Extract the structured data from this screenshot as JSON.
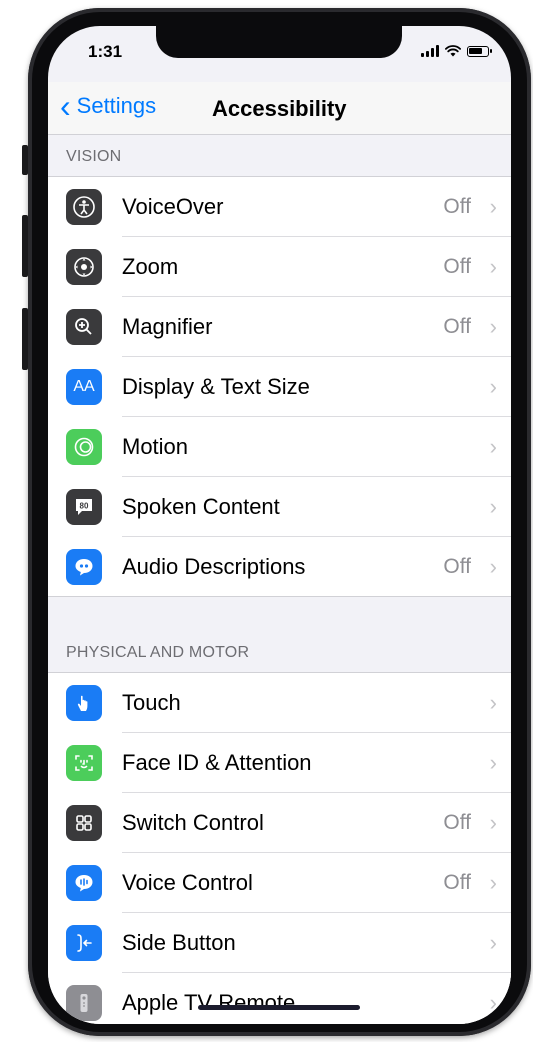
{
  "status": {
    "time": "1:31"
  },
  "nav": {
    "back_label": "Settings",
    "title": "Accessibility"
  },
  "sections": {
    "vision": {
      "header": "VISION",
      "items": [
        {
          "label": "VoiceOver",
          "value": "Off",
          "icon": "voiceover-icon",
          "color": "#3a3a3c"
        },
        {
          "label": "Zoom",
          "value": "Off",
          "icon": "zoom-icon",
          "color": "#3a3a3c"
        },
        {
          "label": "Magnifier",
          "value": "Off",
          "icon": "magnifier-icon",
          "color": "#3a3a3c"
        },
        {
          "label": "Display & Text Size",
          "value": "",
          "icon": "display-text-size-icon",
          "color": "#1a7cf5"
        },
        {
          "label": "Motion",
          "value": "",
          "icon": "motion-icon",
          "color": "#4ccd5b"
        },
        {
          "label": "Spoken Content",
          "value": "",
          "icon": "spoken-content-icon",
          "color": "#3a3a3c"
        },
        {
          "label": "Audio Descriptions",
          "value": "Off",
          "icon": "audio-descriptions-icon",
          "color": "#1a7cf5"
        }
      ]
    },
    "physical": {
      "header": "PHYSICAL AND MOTOR",
      "items": [
        {
          "label": "Touch",
          "value": "",
          "icon": "touch-icon",
          "color": "#1a7cf5"
        },
        {
          "label": "Face ID & Attention",
          "value": "",
          "icon": "face-id-icon",
          "color": "#4ccd5b"
        },
        {
          "label": "Switch Control",
          "value": "Off",
          "icon": "switch-control-icon",
          "color": "#3a3a3c"
        },
        {
          "label": "Voice Control",
          "value": "Off",
          "icon": "voice-control-icon",
          "color": "#1a7cf5"
        },
        {
          "label": "Side Button",
          "value": "",
          "icon": "side-button-icon",
          "color": "#1a7cf5"
        },
        {
          "label": "Apple TV Remote",
          "value": "",
          "icon": "apple-tv-remote-icon",
          "color": "#8e8e93"
        }
      ]
    }
  }
}
